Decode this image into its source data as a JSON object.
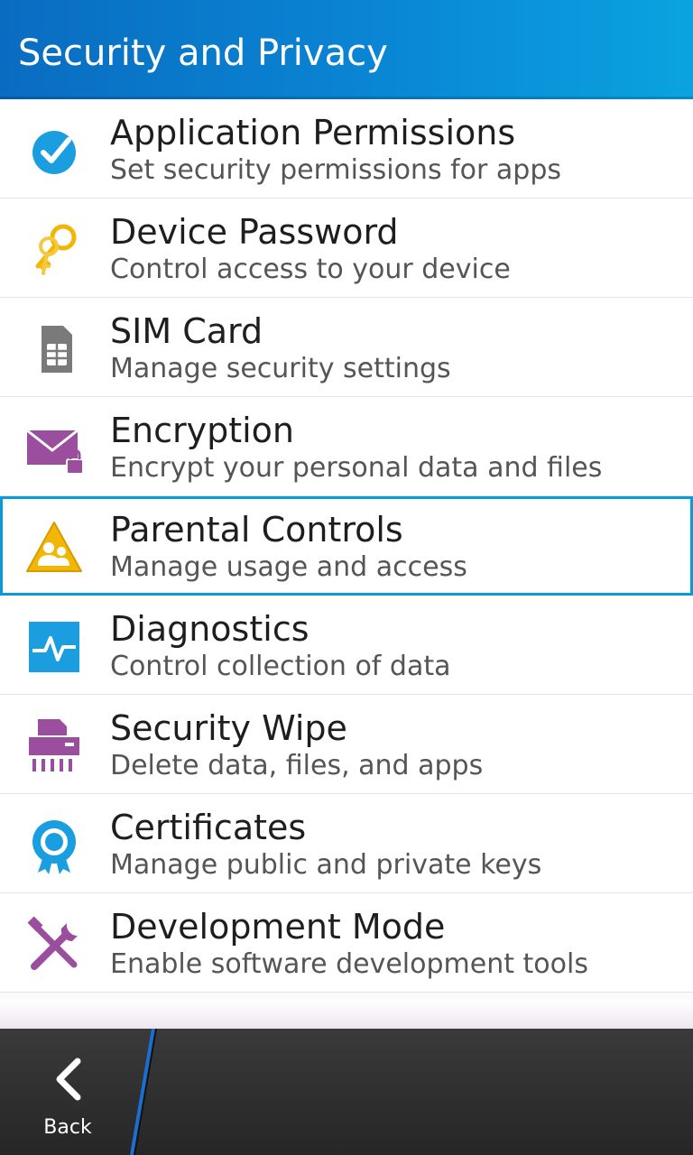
{
  "header": {
    "title": "Security and Privacy"
  },
  "items": [
    {
      "title": "Application Permissions",
      "subtitle": "Set security permissions for apps",
      "icon": "checkmark-icon"
    },
    {
      "title": "Device Password",
      "subtitle": "Control access to your device",
      "icon": "keys-icon"
    },
    {
      "title": "SIM Card",
      "subtitle": "Manage security settings",
      "icon": "sim-card-icon"
    },
    {
      "title": "Encryption",
      "subtitle": "Encrypt your personal data and files",
      "icon": "envelope-lock-icon"
    },
    {
      "title": "Parental Controls",
      "subtitle": "Manage usage and access",
      "icon": "parental-warning-icon",
      "selected": true
    },
    {
      "title": "Diagnostics",
      "subtitle": "Control collection of data",
      "icon": "pulse-icon"
    },
    {
      "title": "Security Wipe",
      "subtitle": "Delete data, files, and apps",
      "icon": "shredder-icon"
    },
    {
      "title": "Certificates",
      "subtitle": "Manage public and private keys",
      "icon": "certificate-icon"
    },
    {
      "title": "Development Mode",
      "subtitle": "Enable software development tools",
      "icon": "tools-icon"
    }
  ],
  "action_bar": {
    "back_label": "Back"
  },
  "colors": {
    "header": "#0a86d4",
    "selection": "#0a9ad8",
    "blue_icon": "#1a9ee0",
    "purple_icon": "#9b4d9e",
    "gold_icon": "#f2b705",
    "gray_icon": "#777777"
  }
}
